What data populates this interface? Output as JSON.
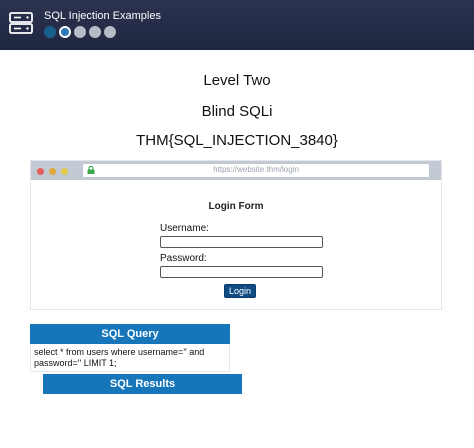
{
  "app": {
    "title": "SQL Injection Examples",
    "icon": "server-icon",
    "steps": [
      {
        "state": "done"
      },
      {
        "state": "active"
      },
      {
        "state": "pending"
      },
      {
        "state": "pending"
      },
      {
        "state": "pending"
      }
    ]
  },
  "challenge": {
    "level": "Level Two",
    "name": "Blind SQLi",
    "flag": "THM{SQL_INJECTION_3840}"
  },
  "browser": {
    "url": "https://website.thm/login",
    "lock_icon": "lock-icon"
  },
  "login_form": {
    "title": "Login Form",
    "username_label": "Username:",
    "username_value": "",
    "password_label": "Password:",
    "password_value": "",
    "login_button": "Login"
  },
  "sql_query": {
    "header": "SQL Query",
    "text": "select * from users where username='' and password='' LIMIT 1;"
  },
  "sql_results": {
    "header": "SQL Results"
  },
  "colors": {
    "topbar": "#2b3350",
    "accent": "#1676b9",
    "button": "#0f4c84"
  }
}
